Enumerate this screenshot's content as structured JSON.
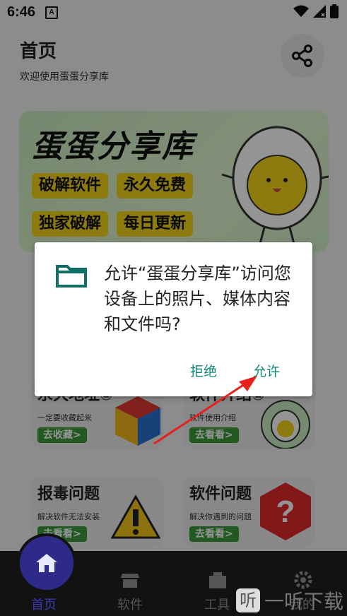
{
  "status_bar": {
    "time": "6:46",
    "notif_letter": "A"
  },
  "header": {
    "title": "首页",
    "subtitle": "欢迎使用蛋蛋分享库"
  },
  "banner": {
    "title": "蛋蛋分享库",
    "tags": [
      "破解软件",
      "永久免费",
      "独家破解",
      "每日更新"
    ]
  },
  "cards": [
    {
      "title": "永久地址①",
      "subtitle": "一定要收藏起来",
      "button": "去收藏>"
    },
    {
      "title": "软件介绍②",
      "subtitle": "软件使用介绍",
      "button": "去看看>"
    },
    {
      "title": "报毒问题",
      "subtitle": "解决软件无法安装",
      "button": "去看看>"
    },
    {
      "title": "软件问题",
      "subtitle": "解决你遇到的问题",
      "button": "去看看>"
    }
  ],
  "dialog": {
    "message": "允许“蛋蛋分享库”访问您设备上的照片、媒体内容和文件吗?",
    "deny_label": "拒绝",
    "allow_label": "允许"
  },
  "bottom_nav": {
    "items": [
      {
        "label": "首页",
        "icon": "home-icon",
        "active": true
      },
      {
        "label": "软件",
        "icon": "store-icon",
        "active": false
      },
      {
        "label": "工具",
        "icon": "toolbox-icon",
        "active": false
      },
      {
        "label": "我的",
        "icon": "settings-icon",
        "active": false
      }
    ]
  },
  "watermark": {
    "text": "一听下载",
    "icon_char": "听"
  },
  "colors": {
    "accent": "#0f8a7a",
    "nav_active": "#3c38b3",
    "tag_yellow": "#f3d41d",
    "card_button": "#3a9a3a"
  }
}
